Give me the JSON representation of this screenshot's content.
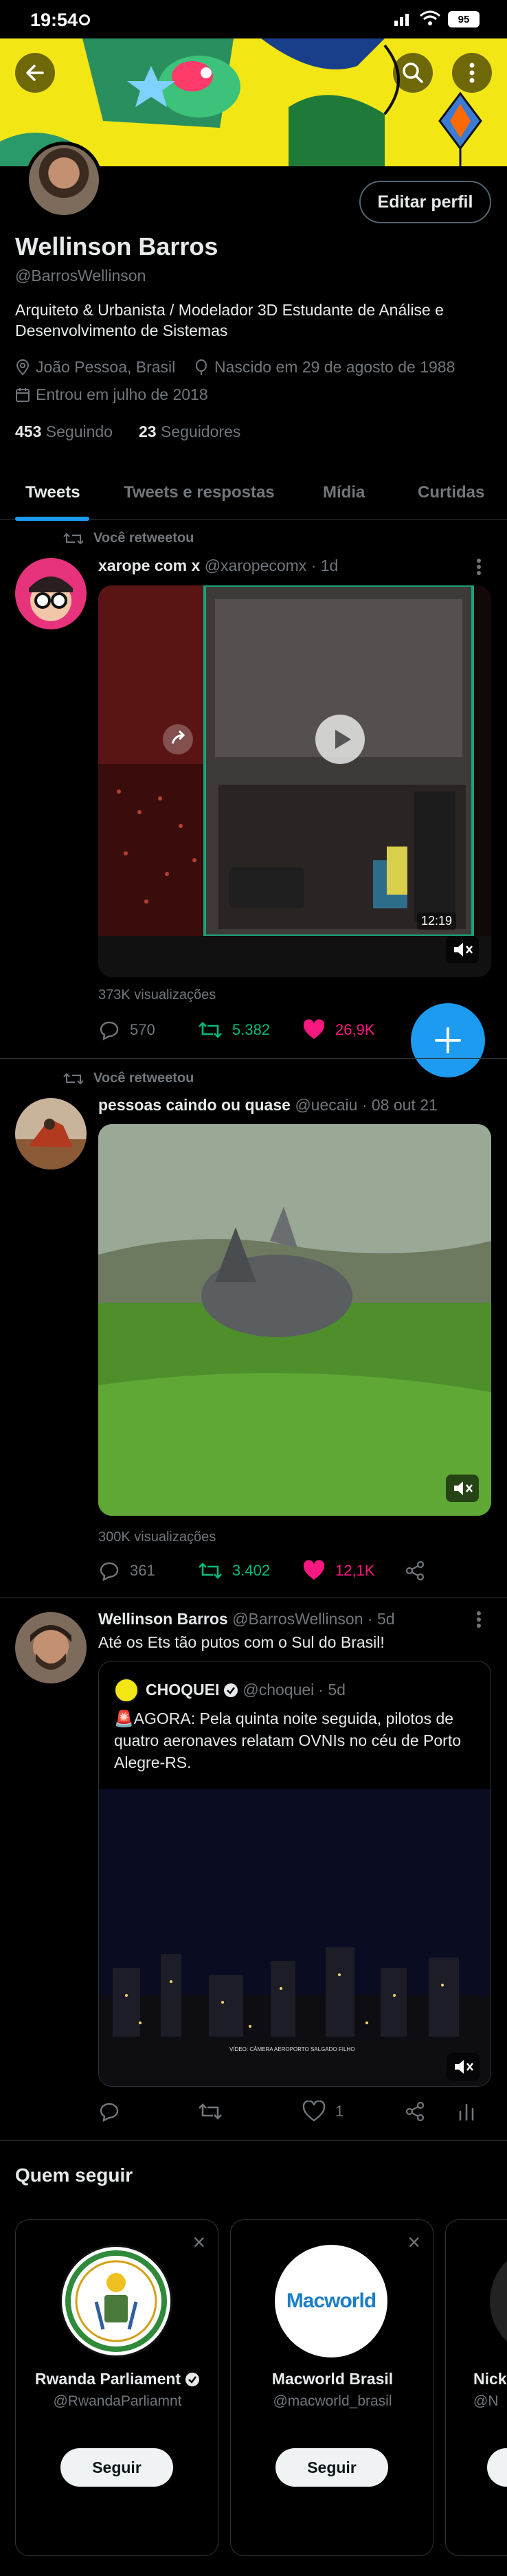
{
  "status_bar": {
    "time": "19:54",
    "battery": "95"
  },
  "profile": {
    "name": "Wellinson Barros",
    "handle": "@BarrosWellinson",
    "edit_label": "Editar perfil",
    "bio_line1": "Arquiteto & Urbanista / Modelador 3D Estudante de Análise e",
    "bio_line2": "Desenvolvimento de Sistemas",
    "location": "João Pessoa, Brasil",
    "birth": "Nascido em 29 de agosto de 1988",
    "joined": "Entrou em julho de 2018",
    "following_count": "453",
    "following_label": "Seguindo",
    "followers_count": "23",
    "followers_label": "Seguidores"
  },
  "tabs": [
    "Tweets",
    "Tweets e respostas",
    "Mídia",
    "Curtidas"
  ],
  "tweets": [
    {
      "retweet_label": "Você retweetou",
      "name": "xarope com x",
      "handle": "@xaropecomx",
      "time": "· 1d",
      "video_time": "12:19",
      "views": "373K visualizações",
      "replies": "570",
      "retweets": "5.382",
      "likes": "26,9K"
    },
    {
      "retweet_label": "Você retweetou",
      "name": "pessoas caindo ou quase",
      "handle": "@uecaiu",
      "time": "· 08 out 21",
      "views": "300K visualizações",
      "replies": "361",
      "retweets": "3.402",
      "likes": "12,1K"
    },
    {
      "name": "Wellinson Barros",
      "handle": "@BarrosWellinson",
      "time": "· 5d",
      "text": "Até os Ets tão putos com o Sul do Brasil!",
      "quote": {
        "name": "CHOQUEI",
        "handle": "@choquei",
        "time": "· 5d",
        "text_line1": "🚨AGORA: Pela quinta noite seguida, pilotos de",
        "text_line2": "quatro aeronaves relatam OVNIs no céu de Porto",
        "text_line3": "Alegre-RS.",
        "video_caption": "VÍDEO: CÂMERA AEROPORTO SALGADO FILHO"
      },
      "likes": "1"
    }
  ],
  "who_to_follow": {
    "title": "Quem seguir",
    "follow_label": "Seguir",
    "cards": [
      {
        "name": "Rwanda Parliament",
        "handle": "@RwandaParliamnt"
      },
      {
        "name": "Macworld Brasil",
        "handle": "@macworld_brasil",
        "logo_text": "Macworld"
      },
      {
        "name": "Nick",
        "handle": "@N"
      }
    ]
  },
  "colors": {
    "accent": "#1d9bf0",
    "like": "#f91880",
    "retweet": "#00ba7c",
    "banner": "#f3e615"
  }
}
